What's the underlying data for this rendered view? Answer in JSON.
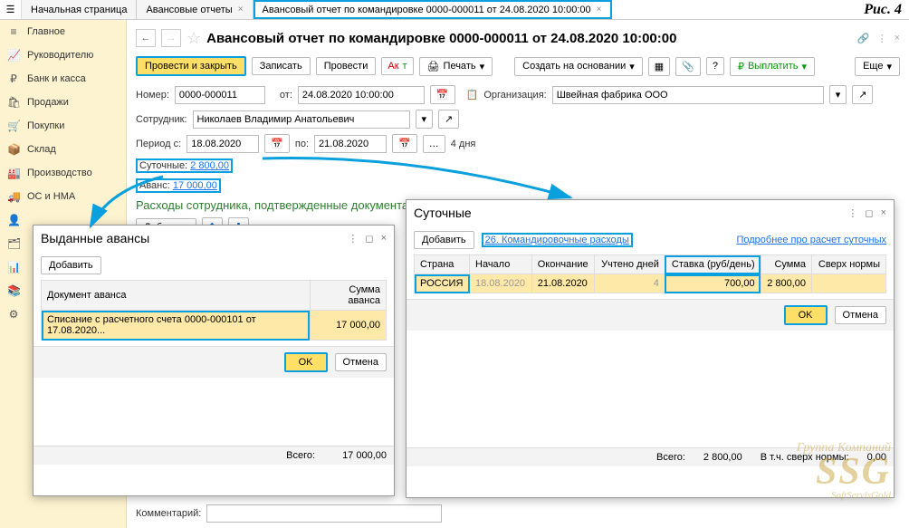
{
  "figLabel": "Рис. 4",
  "tabs": {
    "home": "Начальная страница",
    "t1": "Авансовые отчеты",
    "t2": "Авансовый отчет по командировке 0000-000011 от 24.08.2020 10:00:00"
  },
  "sidebar": [
    {
      "icon": "≡",
      "label": "Главное"
    },
    {
      "icon": "📈",
      "label": "Руководителю"
    },
    {
      "icon": "₽",
      "label": "Банк и касса"
    },
    {
      "icon": "🛍",
      "label": "Продажи"
    },
    {
      "icon": "🛒",
      "label": "Покупки"
    },
    {
      "icon": "📦",
      "label": "Склад"
    },
    {
      "icon": "🏭",
      "label": "Производство"
    },
    {
      "icon": "🚚",
      "label": "ОС и НМА"
    },
    {
      "icon": "👤",
      "label": ""
    },
    {
      "icon": "🗂",
      "label": ""
    },
    {
      "icon": "📊",
      "label": ""
    },
    {
      "icon": "📚",
      "label": ""
    },
    {
      "icon": "⚙",
      "label": ""
    }
  ],
  "docTitle": "Авансовый отчет по командировке 0000-000011 от 24.08.2020 10:00:00",
  "toolbar": {
    "postClose": "Провести и закрыть",
    "write": "Записать",
    "post": "Провести",
    "print": "Печать",
    "createBased": "Создать на основании",
    "help": "?",
    "payout": "Выплатить",
    "more": "Еще"
  },
  "fields": {
    "numLabel": "Номер:",
    "num": "0000-000011",
    "fromLabel": "от:",
    "from": "24.08.2020 10:00:00",
    "orgLabel": "Организация:",
    "org": "Швейная фабрика ООО",
    "empLabel": "Сотрудник:",
    "emp": "Николаев Владимир Анатольевич",
    "periodFrom": "Период с:",
    "pFrom": "18.08.2020",
    "to": "по:",
    "pTo": "21.08.2020",
    "days": "4 дня",
    "perDiemLabel": "Суточные:",
    "perDiem": "2 800,00",
    "advanceLabel": "Аванс:",
    "advance": "17 000,00",
    "sectionExpenses": "Расходы сотрудника, подтвержденные документами",
    "add": "Добавить",
    "commentLabel": "Комментарий:"
  },
  "popupAdvances": {
    "title": "Выданные авансы",
    "add": "Добавить",
    "col1": "Документ аванса",
    "col2": "Сумма аванса",
    "rowDoc": "Списание с расчетного счета 0000-000101 от 17.08.2020...",
    "rowSum": "17 000,00",
    "totalLabel": "Всего:",
    "total": "17 000,00",
    "ok": "OK",
    "cancel": "Отмена"
  },
  "popupPerDiem": {
    "title": "Суточные",
    "add": "Добавить",
    "templateLink": "26. Командировочные расходы",
    "moreLink": "Подробнее про расчет суточных",
    "cols": {
      "country": "Страна",
      "start": "Начало",
      "end": "Окончание",
      "days": "Учтено дней",
      "rate": "Ставка (руб/день)",
      "sum": "Сумма",
      "over": "Сверх нормы"
    },
    "row": {
      "country": "РОССИЯ",
      "start": "18.08.2020",
      "end": "21.08.2020",
      "days": "4",
      "rate": "700,00",
      "sum": "2 800,00",
      "over": ""
    },
    "totalLabel": "Всего:",
    "total": "2 800,00",
    "overLabel": "В т.ч. сверх нормы:",
    "overTotal": "0,00",
    "ok": "OK",
    "cancel": "Отмена"
  },
  "watermark": {
    "l1": "Группа Компаний",
    "l2": "SSG",
    "l3": "SoftServisGold"
  }
}
